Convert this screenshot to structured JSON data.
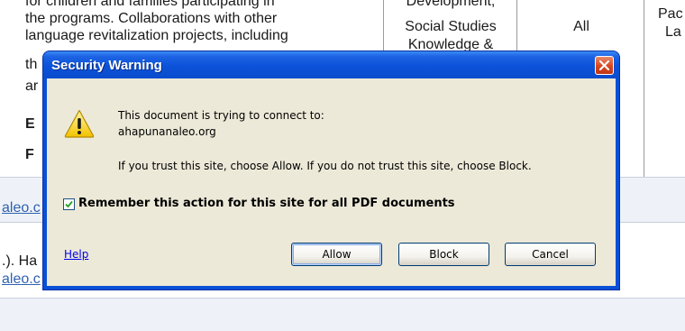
{
  "background_doc": {
    "lines": [
      "for children and families participating in",
      "the programs. Collaborations with other",
      "language revitalization projects, including",
      "th",
      "ar",
      "E",
      "F"
    ],
    "col2_lines": [
      "Development,",
      "Social Studies",
      "Knowledge &"
    ],
    "col3_text": "All",
    "col4_lines": [
      "Pac",
      "La"
    ],
    "row2_link": "aleo.c",
    "row3_text": ".). Ha",
    "row3_link": "aleo.c"
  },
  "dialog": {
    "title": "Security Warning",
    "message_line1": "This document is trying to connect to:",
    "message_line2": "ahapunanaleo.org",
    "message_line3": "If you trust this site, choose Allow. If you do not trust this site, choose Block.",
    "remember_label": "Remember this action for this site for all PDF documents",
    "remember_checked": true,
    "help_link": "Help",
    "buttons": {
      "allow": "Allow",
      "block": "Block",
      "cancel": "Cancel"
    }
  },
  "colors": {
    "titlebar": "#0a4fd6",
    "dialog_body": "#ece9d8",
    "close_button": "#d6471f",
    "link": "#0000ee"
  },
  "icons": {
    "warning": "warning-icon",
    "close": "close-icon",
    "check": "check-icon"
  }
}
